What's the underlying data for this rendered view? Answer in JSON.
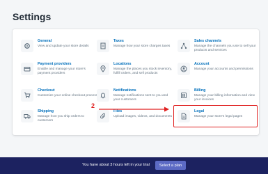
{
  "page": {
    "title": "Settings"
  },
  "items": [
    {
      "title": "General",
      "desc": "View and update your store details",
      "icon": "gear-icon"
    },
    {
      "title": "Taxes",
      "desc": "Manage how your store charges taxes",
      "icon": "receipt-icon"
    },
    {
      "title": "Sales channels",
      "desc": "Manage the channels you use to sell your products and services",
      "icon": "share-icon"
    },
    {
      "title": "Payment providers",
      "desc": "Enable and manage your store's payment providers",
      "icon": "credit-card-icon"
    },
    {
      "title": "Locations",
      "desc": "Manage the places you stock inventory, fulfill orders, and sell products",
      "icon": "location-pin-icon"
    },
    {
      "title": "Account",
      "desc": "Manage your accounts and permissions",
      "icon": "user-icon"
    },
    {
      "title": "Checkout",
      "desc": "Customize your online checkout process",
      "icon": "cart-icon"
    },
    {
      "title": "Notifications",
      "desc": "Manage notifications sent to you and your customers",
      "icon": "bell-icon"
    },
    {
      "title": "Billing",
      "desc": "Manage your billing information and view your invoices",
      "icon": "billing-icon"
    },
    {
      "title": "Shipping",
      "desc": "Manage how you ship orders to customers",
      "icon": "truck-icon"
    },
    {
      "title": "Files",
      "desc": "Upload images, videos, and documents",
      "icon": "paperclip-icon"
    },
    {
      "title": "Legal",
      "desc": "Manage your store's legal pages",
      "icon": "document-icon"
    }
  ],
  "annotation": {
    "step": "2",
    "color": "#e02020"
  },
  "trial_banner": {
    "text": "You have about 3 hours left in your trial",
    "button_label": "Select a plan"
  },
  "colors": {
    "link": "#006fbb",
    "banner_bg": "#1c2260",
    "button_bg": "#5c6ac4"
  }
}
